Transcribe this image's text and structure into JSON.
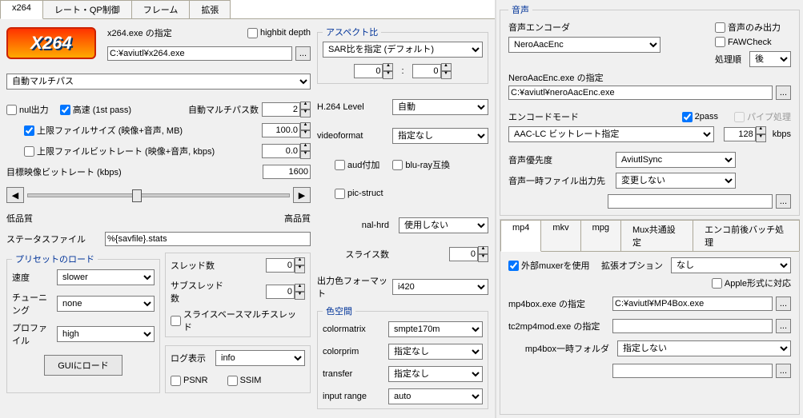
{
  "tabs": {
    "t0": "x264",
    "t1": "レート・QP制御",
    "t2": "フレーム",
    "t3": "拡張"
  },
  "x264": {
    "exe_label": "x264.exe の指定",
    "highbit": "highbit depth",
    "exe_path": "C:¥aviutl¥x264.exe",
    "browse": "...",
    "mode": "自動マルチパス",
    "nul": "nul出力",
    "fast": "高速 (1st pass)",
    "pass_label": "自動マルチパス数",
    "pass_v": "2",
    "maxsize_lbl": "上限ファイルサイズ (映像+音声, MB)",
    "maxsize_v": "100.0",
    "maxbit_lbl": "上限ファイルビットレート (映像+音声, kbps)",
    "maxbit_v": "0.0",
    "target_lbl": "目標映像ビットレート (kbps)",
    "target_v": "1600",
    "low": "低品質",
    "high": "高品質",
    "stats_lbl": "ステータスファイル",
    "stats_v": "%{savfile}.stats",
    "preset_legend": "プリセットのロード",
    "speed_lbl": "速度",
    "speed_v": "slower",
    "tune_lbl": "チューニング",
    "tune_v": "none",
    "prof_lbl": "プロファイル",
    "prof_v": "high",
    "gui": "GUIにロード",
    "threads_lbl": "スレッド数",
    "threads_v": "0",
    "subthreads_lbl": "サブスレッド数",
    "subthreads_v": "0",
    "sliced": "スライスベースマルチスレッド",
    "log_lbl": "ログ表示",
    "log_v": "info",
    "psnr": "PSNR",
    "ssim": "SSIM",
    "aspect_legend": "アスペクト比",
    "aspect_v": "SAR比を指定 (デフォルト)",
    "asp_l": "0",
    "asp_r": "0",
    "level_lbl": "H.264 Level",
    "level_v": "自動",
    "vf_lbl": "videoformat",
    "vf_v": "指定なし",
    "aud": "aud付加",
    "bd": "blu-ray互換",
    "pic": "pic-struct",
    "nal_lbl": "nal-hrd",
    "nal_v": "使用しない",
    "slice_lbl": "スライス数",
    "slice_v": "0",
    "colf_lbl": "出力色フォーマット",
    "colf_v": "i420",
    "cspace_legend": "色空間",
    "cm_lbl": "colormatrix",
    "cm_v": "smpte170m",
    "cp_lbl": "colorprim",
    "cp_v": "指定なし",
    "tr_lbl": "transfer",
    "tr_v": "指定なし",
    "ir_lbl": "input range",
    "ir_v": "auto"
  },
  "audio": {
    "legend": "音声",
    "enc_lbl": "音声エンコーダ",
    "enc_v": "NeroAacEnc",
    "only": "音声のみ出力",
    "faw": "FAWCheck",
    "order_lbl": "処理順",
    "order_v": "後",
    "exe_lbl": "NeroAacEnc.exe の指定",
    "exe_v": "C:¥aviutl¥neroAacEnc.exe",
    "mode_lbl": "エンコードモード",
    "p2": "2pass",
    "pipe": "パイプ処理",
    "mode_v": "AAC-LC ビットレート指定",
    "br": "128",
    "kbps": "kbps",
    "pri_lbl": "音声優先度",
    "pri_v": "AviutlSync",
    "tmp_lbl": "音声一時ファイル出力先",
    "tmp_v": "変更しない"
  },
  "mux": {
    "t0": "mp4",
    "t1": "mkv",
    "t2": "mpg",
    "t3": "Mux共通設定",
    "t4": "エンコ前後バッチ処理",
    "ext": "外部muxerを使用",
    "extopt_lbl": "拡張オプション",
    "extopt_v": "なし",
    "apple": "Apple形式に対応",
    "mp4box_lbl": "mp4box.exe の指定",
    "mp4box_v": "C:¥aviutl¥MP4Box.exe",
    "tc2_lbl": "tc2mp4mod.exe の指定",
    "tc2_v": "",
    "tmp_lbl": "mp4box一時フォルダ",
    "tmp_v": "指定しない"
  }
}
